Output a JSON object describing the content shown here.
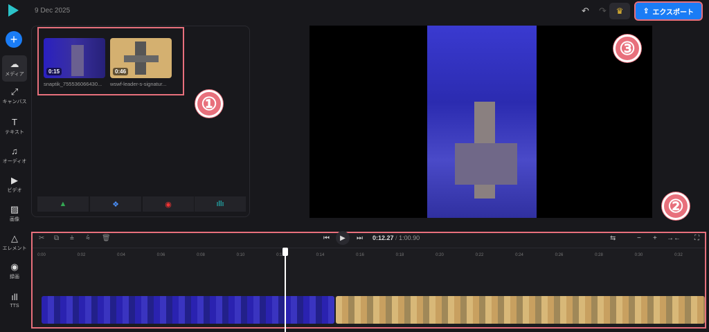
{
  "header": {
    "date": "9 Dec 2025",
    "export_label": "エクスポート"
  },
  "sidebar": {
    "items": [
      {
        "label": "メディア",
        "icon": "☁"
      },
      {
        "label": "キャンバス",
        "icon": "⤢"
      },
      {
        "label": "テキスト",
        "icon": "T"
      },
      {
        "label": "オーディオ",
        "icon": "♫"
      },
      {
        "label": "ビデオ",
        "icon": "▶"
      },
      {
        "label": "画像",
        "icon": "▨"
      },
      {
        "label": "エレメント",
        "icon": "△"
      },
      {
        "label": "録画",
        "icon": "◉"
      },
      {
        "label": "TTS",
        "icon": "ıll"
      }
    ]
  },
  "media": {
    "items": [
      {
        "duration": "0:15",
        "name": "snaptik_755536066430..."
      },
      {
        "duration": "0:46",
        "name": "wswf-leader-s-signatur..."
      }
    ]
  },
  "player": {
    "current": "0:12.27",
    "separator": "/",
    "total": "1:00.90"
  },
  "timeline": {
    "ticks": [
      "0:00",
      "0:02",
      "0:04",
      "0:06",
      "0:08",
      "0:10",
      "0:12",
      "0:14",
      "0:16",
      "0:18",
      "0:20",
      "0:22",
      "0:24",
      "0:26",
      "0:28",
      "0:30",
      "0:32"
    ]
  },
  "annotations": [
    "①",
    "②",
    "③"
  ],
  "colors": {
    "accent": "#1a7cf5",
    "annotation": "#e8707c"
  }
}
